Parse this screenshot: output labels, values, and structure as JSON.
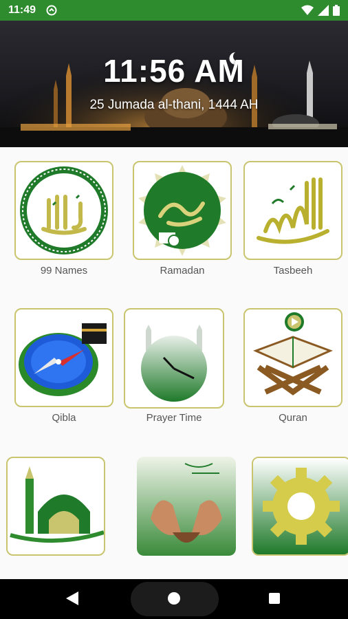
{
  "status_bar": {
    "time": "11:49",
    "icons": [
      "sync-icon",
      "wifi-icon",
      "signal-icon",
      "battery-icon"
    ]
  },
  "header": {
    "clock": "11:56 AM",
    "hijri_date": "25 Jumada al-thani, 1444 AH"
  },
  "menu": {
    "items": [
      {
        "label": "99 Names",
        "icon": "allah-calligraphy-icon"
      },
      {
        "label": "Ramadan",
        "icon": "ramadan-calendar-icon"
      },
      {
        "label": "Tasbeeh",
        "icon": "subhanallah-calligraphy-icon"
      },
      {
        "label": "Qibla",
        "icon": "qibla-compass-icon"
      },
      {
        "label": "Prayer Time",
        "icon": "mosque-clock-icon"
      },
      {
        "label": "Quran",
        "icon": "quran-stand-icon"
      },
      {
        "label": "",
        "icon": "mosque-icon"
      },
      {
        "label": "",
        "icon": "praying-hands-icon"
      },
      {
        "label": "",
        "icon": "gear-icon"
      }
    ]
  },
  "colors": {
    "status_bar": "#2e8b2e",
    "accent_green": "#1f7a2a",
    "accent_gold": "#c9c46e"
  },
  "nav_bar": {
    "icons": [
      "back-icon",
      "home-icon",
      "recent-apps-icon"
    ]
  }
}
